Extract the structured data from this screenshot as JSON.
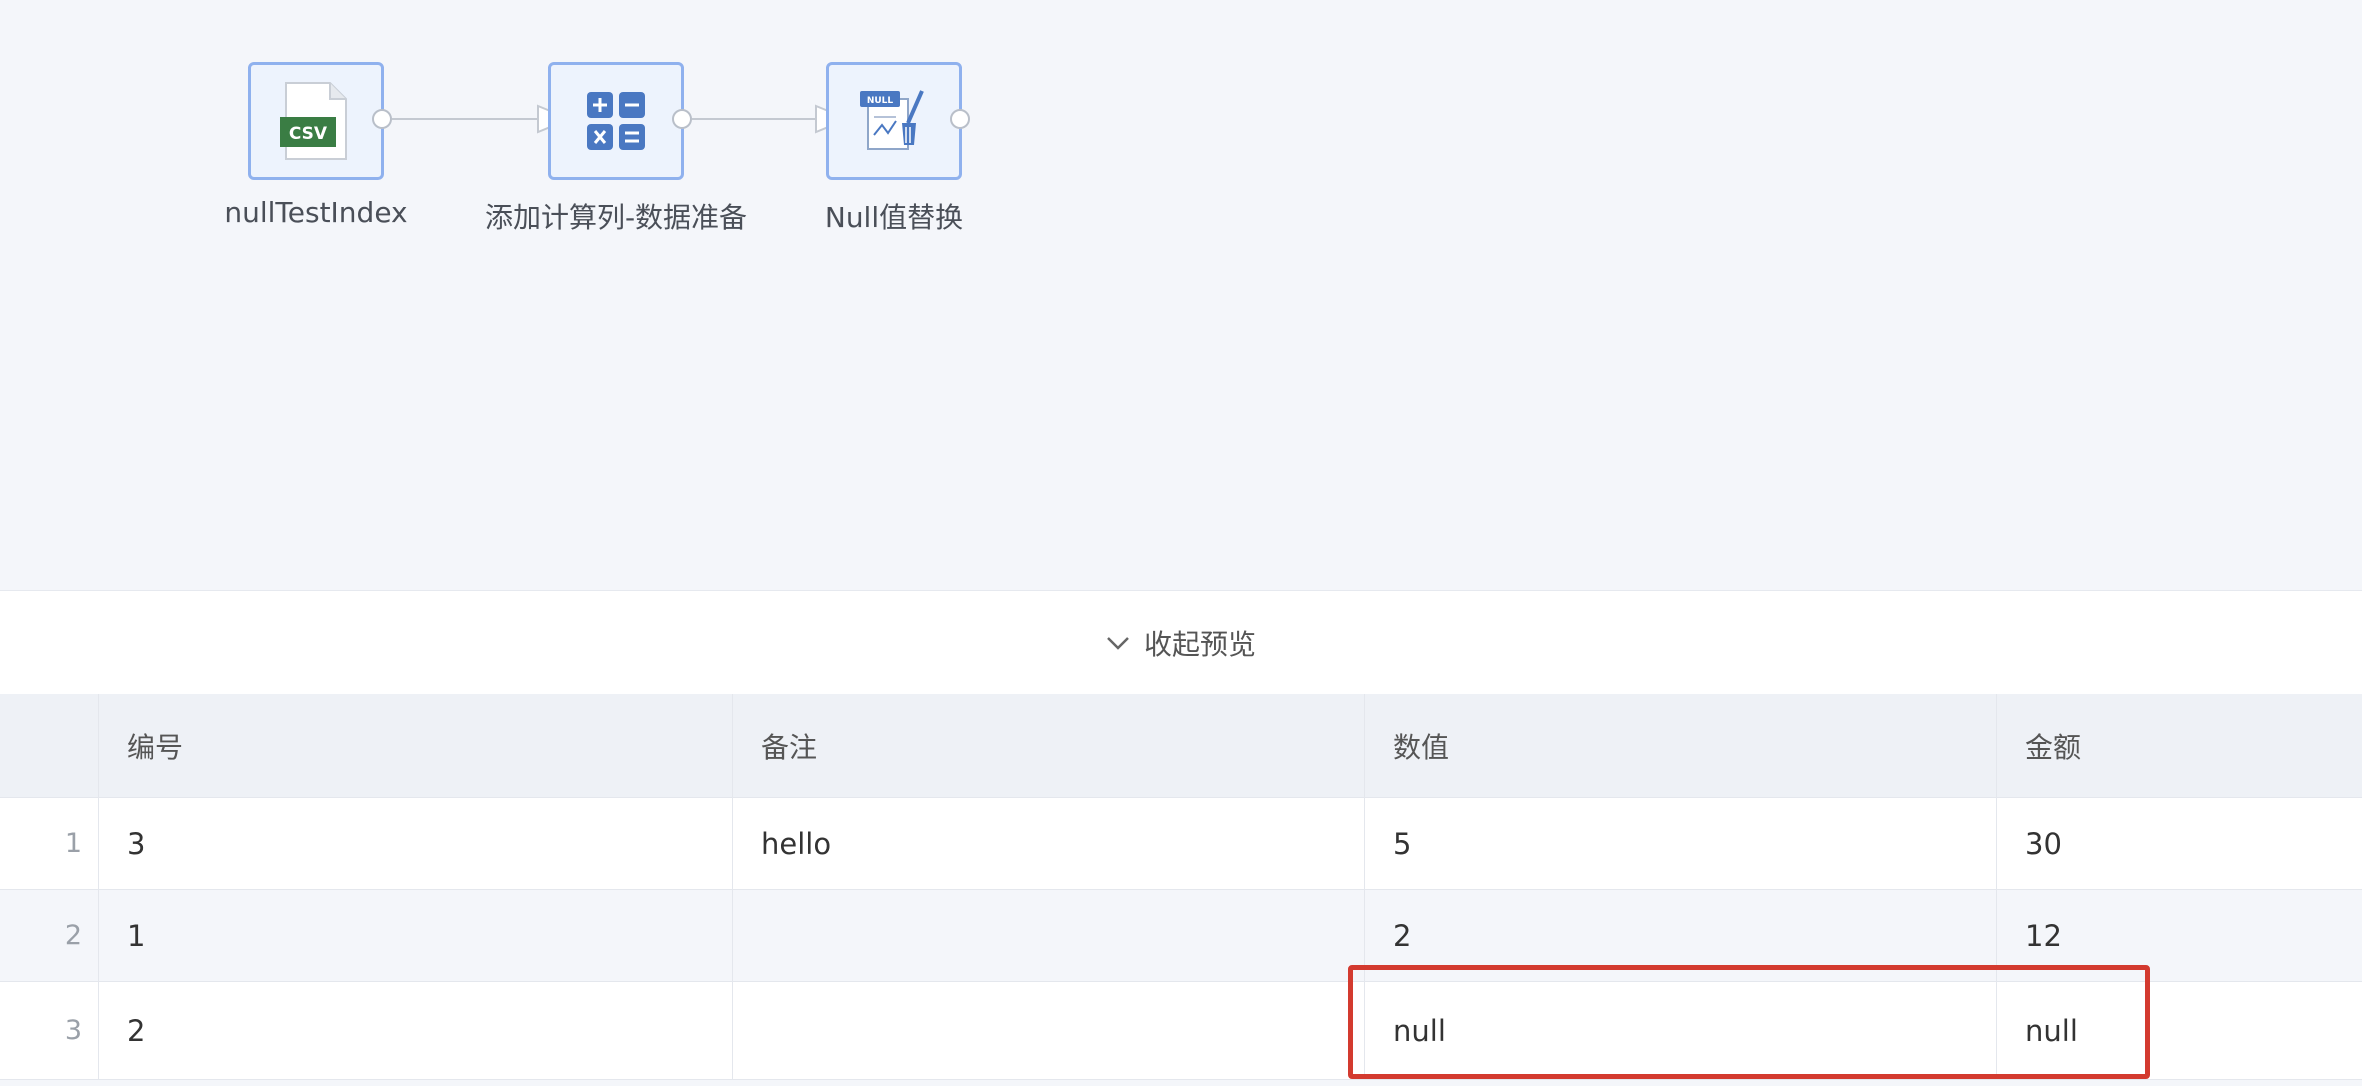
{
  "flow": {
    "nodes": [
      {
        "label": "nullTestIndex",
        "icon": "csv-file-icon"
      },
      {
        "label": "添加计算列-数据准备",
        "icon": "calculator-icon"
      },
      {
        "label": "Null值替换",
        "icon": "null-replace-icon"
      }
    ],
    "csv_badge_text": "CSV",
    "null_badge_text": "NULL"
  },
  "preview": {
    "toggle_label": "收起预览",
    "toggle_icon": "chevron-down-icon"
  },
  "table": {
    "columns": [
      "编号",
      "备注",
      "数值",
      "金额"
    ],
    "rows": [
      {
        "num": "1",
        "cells": [
          "3",
          "hello",
          "5",
          "30"
        ]
      },
      {
        "num": "2",
        "cells": [
          "1",
          "",
          "2",
          "12"
        ]
      },
      {
        "num": "3",
        "cells": [
          "2",
          "",
          "null",
          "null"
        ]
      }
    ]
  },
  "colors": {
    "highlight": "#d33a2f",
    "node_border": "#8fb1ee",
    "csv_green": "#3a7d44",
    "icon_blue": "#4a78c2"
  }
}
